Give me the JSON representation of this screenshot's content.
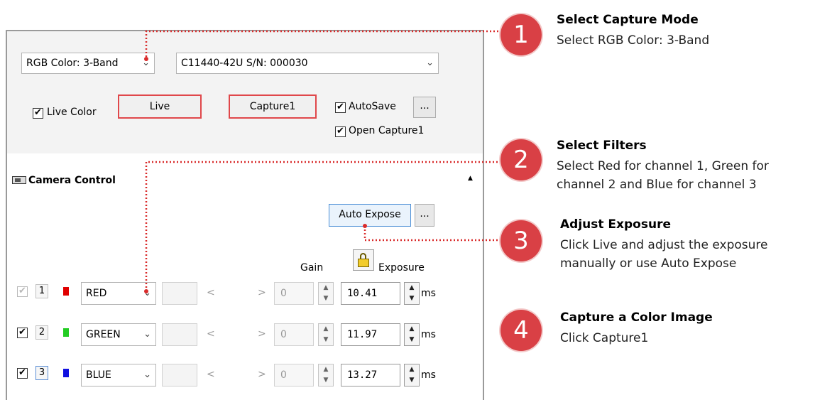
{
  "capture_mode": {
    "value": "RGB Color: 3-Band"
  },
  "camera": {
    "value": "C11440-42U S/N: 000030"
  },
  "live_color": {
    "label": "Live Color",
    "checked": true
  },
  "buttons": {
    "live": "Live",
    "capture": "Capture1",
    "more": "...",
    "auto_expose": "Auto Expose",
    "auto_more": "..."
  },
  "autosave": {
    "label": "AutoSave",
    "checked": true
  },
  "open_capture": {
    "label": "Open Capture1",
    "checked": true
  },
  "camera_control": {
    "title": "Camera Control",
    "collapse_glyph": "▲"
  },
  "column_headers": {
    "gain": "Gain",
    "exposure": "Exposure"
  },
  "channels": [
    {
      "enabled": true,
      "number": "1",
      "color": "#e00000",
      "filter": "RED",
      "gain": "0",
      "exposure": "10.41",
      "unit": "ms"
    },
    {
      "enabled": true,
      "number": "2",
      "color": "#22cc22",
      "filter": "GREEN",
      "gain": "0",
      "exposure": "11.97",
      "unit": "ms"
    },
    {
      "enabled": true,
      "number": "3",
      "color": "#1010e0",
      "filter": "BLUE",
      "gain": "0",
      "exposure": "13.27",
      "unit": "ms"
    }
  ],
  "steps": [
    {
      "number": "1",
      "title": "Select Capture Mode",
      "lines": [
        "Select RGB Color: 3-Band"
      ]
    },
    {
      "number": "2",
      "title": "Select Filters",
      "lines": [
        "Select Red for channel 1, Green for",
        "channel 2 and Blue for channel 3"
      ]
    },
    {
      "number": "3",
      "title": "Adjust Exposure",
      "lines": [
        "Click Live and adjust the exposure",
        "manually or use Auto Expose"
      ]
    },
    {
      "number": "4",
      "title": "Capture a Color Image",
      "lines": [
        "Click Capture1"
      ]
    }
  ],
  "colors": {
    "accent_red": "#d94045",
    "dotted_line": "#d92b2b"
  }
}
